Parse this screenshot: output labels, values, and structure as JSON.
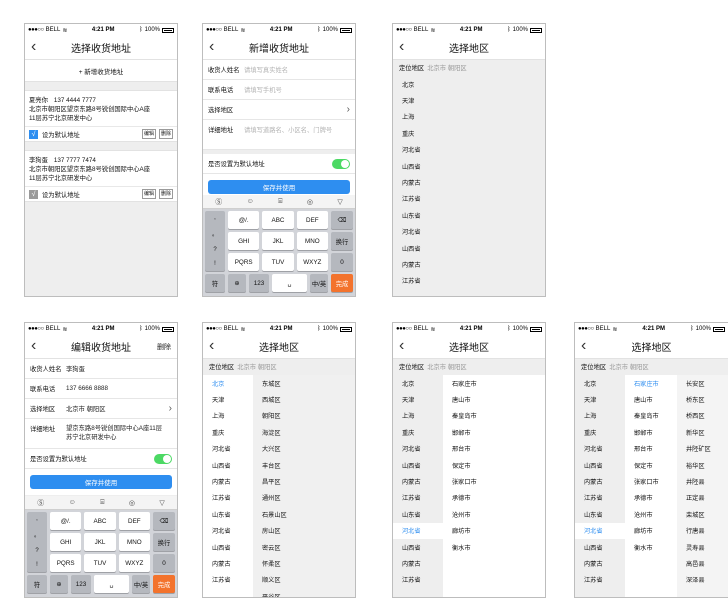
{
  "status": {
    "carrier": "BELL",
    "time": "4:21 PM",
    "battery": "100%"
  },
  "screen1": {
    "title": "选择收货地址",
    "add_label": "+ 新增收货地址",
    "addresses": [
      {
        "name": "夏亮你",
        "phone": "137 4444 7777",
        "line1": "北京市朝阳区望京东路8号锐创国际中心A座",
        "line2": "11层苏宁北京研发中心",
        "default_label": "设为默认地址",
        "edit": "编辑",
        "delete": "删除"
      },
      {
        "name": "李狗蛋",
        "phone": "137 7777 7474",
        "line1": "北京市朝阳区望京东路8号锐创国际中心A座",
        "line2": "11层苏宁北京研发中心",
        "default_label": "设为默认地址",
        "edit": "编辑",
        "delete": "删除"
      }
    ]
  },
  "screen2": {
    "title": "新增收货地址",
    "name_label": "收货人姓名",
    "name_placeholder": "请填写真实姓名",
    "phone_label": "联系电话",
    "phone_placeholder": "请填写手机号",
    "region_label": "选择地区",
    "detail_label": "详细地址",
    "detail_placeholder": "请填写道路名、小区名、门牌号",
    "default_label": "是否设置为默认地址",
    "save": "保存并使用"
  },
  "screen5": {
    "title": "编辑收货地址",
    "delete": "删除",
    "name_label": "收货人姓名",
    "name_value": "李狗蛋",
    "phone_label": "联系电话",
    "phone_value": "137 6666 8888",
    "region_label": "选择地区",
    "region_value": "北京市 朝阳区",
    "detail_label": "详细地址",
    "detail_value": "望京东路8号锐创国际中心A座11层苏宁北京研发中心",
    "default_label": "是否设置为默认地址",
    "save": "保存并使用"
  },
  "keyboard": {
    "tools": [
      "Ⓢ",
      "☺",
      "⌸",
      "◎",
      "▽"
    ],
    "punc": [
      ",",
      "。",
      "?",
      "!"
    ],
    "keys": [
      "@/.",
      "ABC",
      "DEF",
      "GHI",
      "JKL",
      "MNO",
      "PQRS",
      "TUV",
      "WXYZ"
    ],
    "delete": "⌫",
    "next": "换行",
    "zero": "0",
    "symbol": "符",
    "globe": "⊕",
    "num": "123",
    "space": "␣",
    "lang": "中/英",
    "done": "完成"
  },
  "picker": {
    "title": "选择地区",
    "loc_label": "定位地区",
    "loc_value": "北京市 朝阳区",
    "provinces": [
      "北京",
      "天津",
      "上海",
      "重庆",
      "河北省",
      "山西省",
      "内蒙古",
      "江苏省",
      "山东省",
      "河北省",
      "山西省",
      "内蒙古",
      "江苏省"
    ],
    "provinces2": [
      "北京",
      "天津",
      "上海",
      "重庆",
      "河北省",
      "山西省",
      "内蒙古",
      "江苏省",
      "山东省",
      "河北省",
      "山西省",
      "内蒙古",
      "江苏省"
    ],
    "beijing_districts": [
      "东城区",
      "西城区",
      "朝阳区",
      "海淀区",
      "大兴区",
      "丰台区",
      "昌平区",
      "通州区",
      "石景山区",
      "房山区",
      "密云区",
      "怀柔区",
      "顺义区",
      "平谷区"
    ],
    "hebei_cities": [
      "石家庄市",
      "唐山市",
      "秦皇岛市",
      "邯郸市",
      "邢台市",
      "保定市",
      "张家口市",
      "承德市",
      "沧州市",
      "廊坊市",
      "衡水市"
    ],
    "shijiazhuang_districts": [
      "长安区",
      "桥东区",
      "桥西区",
      "新华区",
      "井陉矿区",
      "裕华区",
      "井陉县",
      "正定县",
      "栾城区",
      "行唐县",
      "灵寿县",
      "高邑县",
      "深泽县"
    ]
  }
}
